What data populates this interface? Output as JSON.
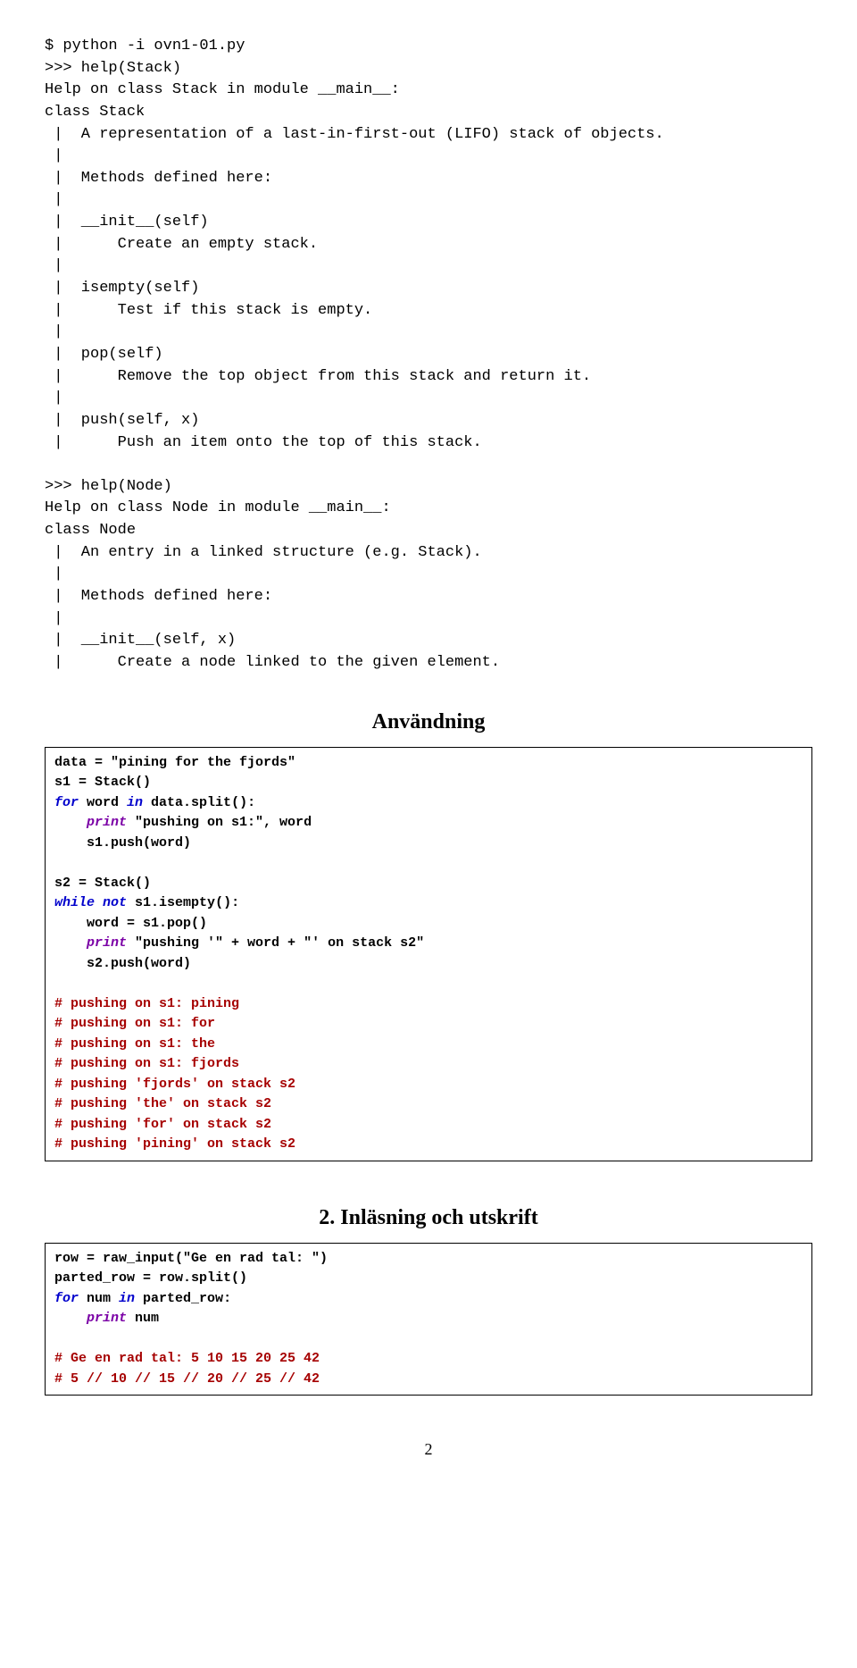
{
  "terminal": {
    "lines": [
      "$ python -i ovn1-01.py",
      ">>> help(Stack)",
      "Help on class Stack in module __main__:",
      "class Stack",
      " |  A representation of a last-in-first-out (LIFO) stack of objects.",
      " |",
      " |  Methods defined here:",
      " |",
      " |  __init__(self)",
      " |      Create an empty stack.",
      " |",
      " |  isempty(self)",
      " |      Test if this stack is empty.",
      " |",
      " |  pop(self)",
      " |      Remove the top object from this stack and return it.",
      " |",
      " |  push(self, x)",
      " |      Push an item onto the top of this stack.",
      "",
      ">>> help(Node)",
      "Help on class Node in module __main__:",
      "class Node",
      " |  An entry in a linked structure (e.g. Stack).",
      " |",
      " |  Methods defined here:",
      " |",
      " |  __init__(self, x)",
      " |      Create a node linked to the given element."
    ]
  },
  "section1": {
    "title": "Användning"
  },
  "code1": {
    "l1a": "data = \"pining for the fjords\"",
    "l2a": "s1 = Stack()",
    "l3_for": "for",
    "l3_mid": " word ",
    "l3_in": "in",
    "l3_end": " data.split():",
    "l4_fn": "print",
    "l4_rest": " \"pushing on s1:\", word",
    "l5a": "    s1.push(word)",
    "blank1": "",
    "l6a": "s2 = Stack()",
    "l7_while": "while",
    "l7_sp": " ",
    "l7_not": "not",
    "l7_end": " s1.isempty():",
    "l8a": "    word = s1.pop()",
    "l9_fn": "print",
    "l9_rest": " \"pushing '\" + word + \"' on stack s2\"",
    "l10a": "    s2.push(word)",
    "blank2": "",
    "c1": "# pushing on s1: pining",
    "c2": "# pushing on s1: for",
    "c3": "# pushing on s1: the",
    "c4": "# pushing on s1: fjords",
    "c5": "# pushing 'fjords' on stack s2",
    "c6": "# pushing 'the' on stack s2",
    "c7": "# pushing 'for' on stack s2",
    "c8": "# pushing 'pining' on stack s2"
  },
  "section2": {
    "title": "2. Inläsning och utskrift"
  },
  "code2": {
    "l1a": "row = raw_input(\"Ge en rad tal: \")",
    "l2a": "parted_row = row.split()",
    "l3_for": "for",
    "l3_mid": " num ",
    "l3_in": "in",
    "l3_end": " parted_row:",
    "l4_fn": "print",
    "l4_rest": " num",
    "blank": "",
    "c1": "# Ge en rad tal: 5 10 15 20 25 42",
    "c2": "# 5 // 10 // 15 // 20 // 25 // 42"
  },
  "page": {
    "number": "2"
  }
}
